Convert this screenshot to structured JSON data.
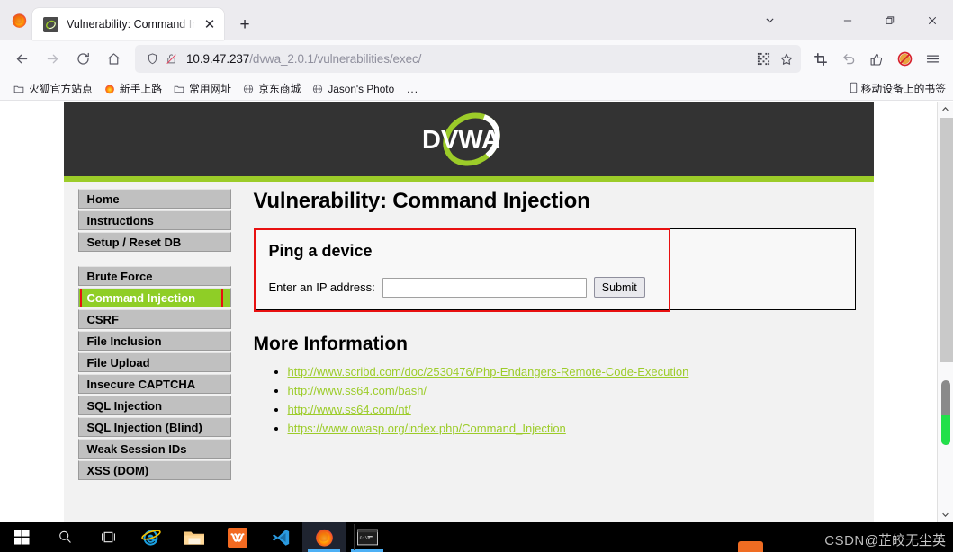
{
  "browser": {
    "tab": {
      "title": "Vulnerability: Command Injec",
      "favicon": "dvwa-favicon",
      "close_label": "✕"
    },
    "newtab_label": "+",
    "window_controls": {
      "tab_list": "chevron-down-icon",
      "minimize": "─",
      "restore": "❐",
      "close": "✕"
    },
    "nav": {
      "back": "←",
      "forward": "→",
      "reload": "↻",
      "home": "⌂"
    },
    "url": {
      "host": "10.9.47.237",
      "path": "/dvwa_2.0.1/vulnerabilities/exec/",
      "full": "10.9.47.237/dvwa_2.0.1/vulnerabilities/exec/"
    },
    "url_icons": {
      "shield": "shield-icon",
      "lock_broken": "broken-lock-icon",
      "qr": "qr-code-icon",
      "bookmark": "star-icon"
    },
    "toolbar_icons": [
      "screenshot-crop-icon",
      "undo-arrow-icon",
      "pocket-save-icon",
      "adblock-icon",
      "hamburger-menu-icon"
    ],
    "bookmarks": [
      {
        "label": "火狐官方站点",
        "icon": "folder-icon"
      },
      {
        "label": "新手上路",
        "icon": "firefox-icon"
      },
      {
        "label": "常用网址",
        "icon": "folder-icon"
      },
      {
        "label": "京东商城",
        "icon": "globe-icon"
      },
      {
        "label": "Jason's Photo",
        "icon": "globe-icon"
      },
      {
        "label": "...",
        "icon": "overflow-icon"
      }
    ],
    "bookmarks_right": {
      "label": "移动设备上的书签",
      "icon": "mobile-icon"
    }
  },
  "page": {
    "logo_text": "DVWA",
    "sidebar": [
      {
        "label": "Home",
        "active": false
      },
      {
        "label": "Instructions",
        "active": false
      },
      {
        "label": "Setup / Reset DB",
        "active": false
      },
      {
        "gap": true
      },
      {
        "label": "Brute Force",
        "active": false
      },
      {
        "label": "Command Injection",
        "active": true
      },
      {
        "label": "CSRF",
        "active": false
      },
      {
        "label": "File Inclusion",
        "active": false
      },
      {
        "label": "File Upload",
        "active": false
      },
      {
        "label": "Insecure CAPTCHA",
        "active": false
      },
      {
        "label": "SQL Injection",
        "active": false
      },
      {
        "label": "SQL Injection (Blind)",
        "active": false
      },
      {
        "label": "Weak Session IDs",
        "active": false
      },
      {
        "label": "XSS (DOM)",
        "active": false
      }
    ],
    "heading": "Vulnerability: Command Injection",
    "panel": {
      "title": "Ping a device",
      "input_label": "Enter an IP address:",
      "input_value": "",
      "input_placeholder": "",
      "submit_label": "Submit"
    },
    "more_info_heading": "More Information",
    "links": [
      "http://www.scribd.com/doc/2530476/Php-Endangers-Remote-Code-Execution",
      "http://www.ss64.com/bash/",
      "http://www.ss64.com/nt/",
      "https://www.owasp.org/index.php/Command_Injection"
    ]
  },
  "taskbar": {
    "items": [
      {
        "name": "start-button",
        "icon": "windows-logo-icon",
        "active": false,
        "running": false
      },
      {
        "name": "search-button",
        "icon": "search-icon",
        "active": false,
        "running": false
      },
      {
        "name": "task-view-button",
        "icon": "task-view-icon",
        "active": false,
        "running": false
      },
      {
        "name": "internet-explorer",
        "icon": "internet-explorer-icon",
        "active": false,
        "running": false
      },
      {
        "name": "file-explorer",
        "icon": "folder-icon",
        "active": false,
        "running": false
      },
      {
        "name": "xampp",
        "icon": "xampp-icon",
        "active": false,
        "running": false
      },
      {
        "name": "vscode",
        "icon": "vscode-icon",
        "active": false,
        "running": false
      },
      {
        "name": "firefox",
        "icon": "firefox-icon",
        "active": true,
        "running": true
      },
      {
        "name": "command-prompt",
        "icon": "terminal-icon",
        "active": false,
        "running": true
      }
    ],
    "watermark_prefix": "CSDN",
    "watermark_suffix": "@芷皎无尘英"
  },
  "colors": {
    "dvwa_green": "#9ccc29",
    "dvwa_dark": "#333333",
    "active_menu": "#8fce26",
    "annotation_red": "#e81111",
    "menu_gray": "#c0c0c0",
    "scroll_green": "#22e04a"
  }
}
